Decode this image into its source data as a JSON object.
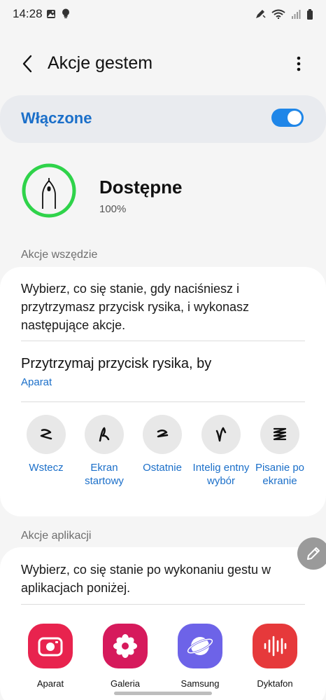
{
  "status_bar": {
    "time": "14:28",
    "left_icons": [
      "image-icon",
      "bulb-icon"
    ],
    "right_icons": [
      "pen-icon",
      "wifi-icon",
      "signal-icon",
      "battery-icon"
    ]
  },
  "header": {
    "title": "Akcje gestem",
    "back_icon": "back-arrow-icon",
    "more_icon": "more-vert-icon"
  },
  "master_switch": {
    "label": "Włączone",
    "on": true
  },
  "battery": {
    "title": "Dostępne",
    "value": "100%"
  },
  "section_everywhere": {
    "header": "Akcje wszędzie",
    "description": "Wybierz, co się stanie, gdy naciśniesz i przytrzymasz przycisk rysika, i wykonasz następujące akcje.",
    "hold": {
      "title": "Przytrzymaj przycisk rysika, by",
      "value": "Aparat"
    },
    "gestures": [
      {
        "label": "Wstecz",
        "icon": "gesture-back-icon"
      },
      {
        "label": "Ekran startowy",
        "icon": "gesture-home-icon"
      },
      {
        "label": "Ostatnie",
        "icon": "gesture-recent-icon"
      },
      {
        "label": "Intelig entny wybór",
        "icon": "gesture-smart-select-icon"
      },
      {
        "label": "Pisanie po ekranie",
        "icon": "gesture-screen-write-icon"
      }
    ]
  },
  "section_apps": {
    "header": "Akcje aplikacji",
    "description": "Wybierz, co się stanie po wykonaniu gestu w aplikacjach poniżej.",
    "apps": [
      {
        "label": "Aparat",
        "icon": "camera-app-icon",
        "color": "#e8234e"
      },
      {
        "label": "Galeria",
        "icon": "gallery-app-icon",
        "color": "#d61a5c"
      },
      {
        "label": "Samsung",
        "icon": "samsung-internet-icon",
        "color": "#6d63e8"
      },
      {
        "label": "Dyktafon",
        "icon": "voice-recorder-icon",
        "color": "#e6393b"
      }
    ]
  },
  "colors": {
    "accent": "#1b6fc9",
    "toggle": "#1f86e8",
    "battery_ring": "#2fd34a"
  }
}
